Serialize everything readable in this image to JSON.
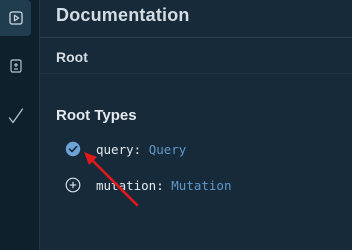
{
  "sidebar": {
    "items": [
      {
        "icon": "docs-play-icon",
        "active": true
      },
      {
        "icon": "history-icon",
        "active": false
      },
      {
        "icon": "checkmark-icon",
        "active": false
      }
    ]
  },
  "docs": {
    "title": "Documentation",
    "breadcrumb": "Root",
    "section_title": "Root Types",
    "root_types": [
      {
        "name": "query",
        "type": "Query",
        "state": "selected"
      },
      {
        "name": "mutation",
        "type": "Mutation",
        "state": "collapsed"
      }
    ]
  },
  "colors": {
    "background": "#172a3a",
    "sidebar": "#0f202d",
    "type_link": "#5f98c8",
    "selected_check": "#6ea3d6",
    "annotation_arrow": "#e01a1a"
  }
}
